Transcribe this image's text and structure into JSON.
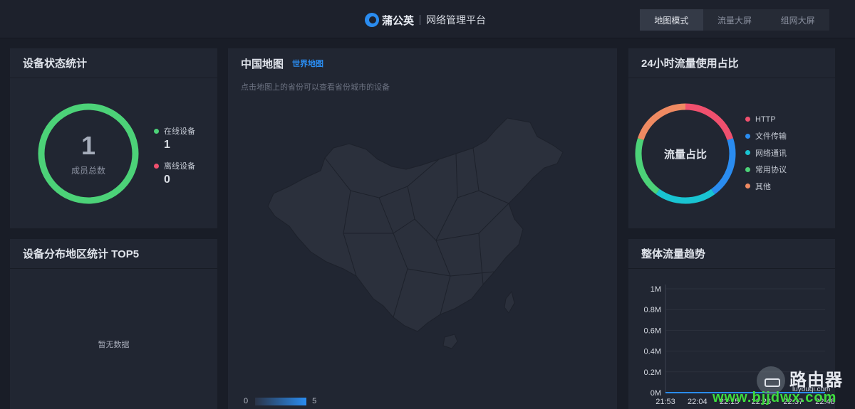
{
  "header": {
    "brand_name": "蒲公英",
    "brand_sub": "网络管理平台",
    "tabs": [
      {
        "label": "地图模式",
        "active": true
      },
      {
        "label": "流量大屏",
        "active": false
      },
      {
        "label": "组网大屏",
        "active": false
      }
    ]
  },
  "status_panel": {
    "title": "设备状态统计",
    "total": "1",
    "total_label": "成员总数",
    "online_label": "在线设备",
    "online_value": "1",
    "offline_label": "离线设备",
    "offline_value": "0",
    "colors": {
      "online": "#4cd278",
      "offline": "#f0506e"
    }
  },
  "region_panel": {
    "title": "设备分布地区统计 TOP5",
    "empty_text": "暂无数据"
  },
  "map_panel": {
    "title": "中国地图",
    "world_link": "世界地图",
    "hint": "点击地图上的省份可以查看省份城市的设备",
    "scale_min": "0",
    "scale_max": "5"
  },
  "ratio_panel": {
    "title": "24小时流量使用占比",
    "center_label": "流量占比",
    "legend": [
      {
        "label": "HTTP",
        "color": "#f0506e"
      },
      {
        "label": "文件传输",
        "color": "#2a8cf0"
      },
      {
        "label": "网络通讯",
        "color": "#19c4d2"
      },
      {
        "label": "常用协议",
        "color": "#4cd278"
      },
      {
        "label": "其他",
        "color": "#ef8a62"
      }
    ]
  },
  "trend_panel": {
    "title": "整体流量趋势",
    "y_ticks": [
      "1M",
      "0.8M",
      "0.6M",
      "0.4M",
      "0.2M",
      "0M"
    ],
    "x_ticks": [
      "21:53",
      "22:04",
      "22:15",
      "22:26",
      "22:37",
      "22:48"
    ]
  },
  "chart_data": {
    "type": "line",
    "x": [
      "21:53",
      "22:04",
      "22:15",
      "22:26",
      "22:37",
      "22:48"
    ],
    "series": [
      {
        "values": [
          0,
          0,
          0,
          0,
          0,
          0
        ]
      }
    ],
    "y_ticks": [
      "0M",
      "0.2M",
      "0.4M",
      "0.6M",
      "0.8M",
      "1M"
    ],
    "ylim": [
      0,
      1
    ],
    "grid": true,
    "color": "#2a8cf0"
  },
  "watermark": {
    "cn": "路由器",
    "pinyin": "luyouqi.com",
    "url": "www.bjjdwx.com"
  }
}
